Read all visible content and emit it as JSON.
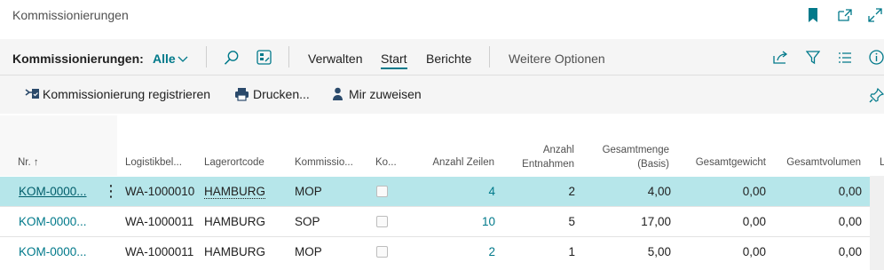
{
  "page_title": "Kommissionierungen",
  "actionbar": {
    "list_label": "Kommissionierungen:",
    "filter_value": "Alle",
    "tabs": [
      "Verwalten",
      "Start",
      "Berichte"
    ],
    "active_tab": "Start",
    "more_options": "Weitere Optionen"
  },
  "promoted_actions": [
    "Kommissionierung registrieren",
    "Drucken...",
    "Mir zuweisen"
  ],
  "columns": {
    "nr": "Nr.",
    "logistik": "Logistikbel...",
    "lagerort": "Lagerortcode",
    "kommissio": "Kommissio...",
    "ko": "Ko...",
    "anzahl_zeilen": "Anzahl Zeilen",
    "anzahl_entnahmen_1": "Anzahl",
    "anzahl_entnahmen_2": "Entnahmen",
    "gesamtmenge_1": "Gesamtmenge",
    "gesamtmenge_2": "(Basis)",
    "gesamtgewicht": "Gesamtgewicht",
    "gesamtvolumen": "Gesamtvolumen",
    "partial": "L"
  },
  "rows": [
    {
      "nr": "KOM-0000...",
      "logistik": "WA-1000010",
      "lagerort": "HAMBURG",
      "kommissio": "MOP",
      "anzahl_zeilen": "4",
      "anzahl_entnahmen": "2",
      "gesamtmenge": "4,00",
      "gesamtgewicht": "0,00",
      "gesamtvolumen": "0,00"
    },
    {
      "nr": "KOM-0000...",
      "logistik": "WA-1000011",
      "lagerort": "HAMBURG",
      "kommissio": "SOP",
      "anzahl_zeilen": "10",
      "anzahl_entnahmen": "5",
      "gesamtmenge": "17,00",
      "gesamtgewicht": "0,00",
      "gesamtvolumen": "0,00"
    },
    {
      "nr": "KOM-0000...",
      "logistik": "WA-1000011",
      "lagerort": "HAMBURG",
      "kommissio": "MOP",
      "anzahl_zeilen": "2",
      "anzahl_entnahmen": "1",
      "gesamtmenge": "5,00",
      "gesamtgewicht": "0,00",
      "gesamtvolumen": "0,00"
    }
  ],
  "selected_row": 0,
  "colors": {
    "accent": "#00798a",
    "selected_row": "#b6e6ea",
    "row_border": "#e3e3e3"
  }
}
